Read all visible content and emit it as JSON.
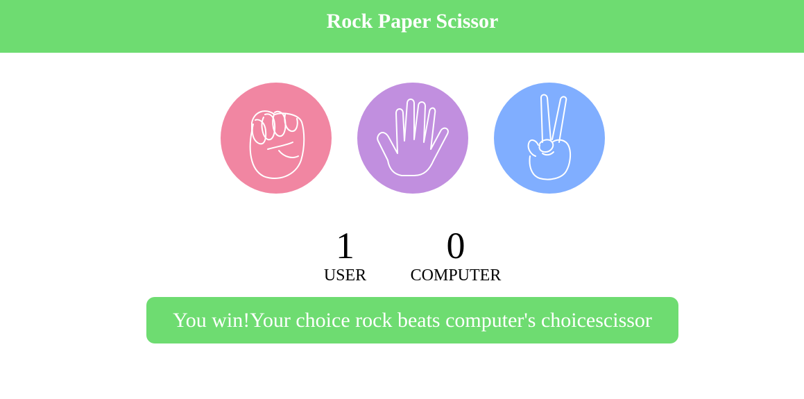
{
  "header": {
    "title": "Rock Paper Scissor"
  },
  "choices": [
    {
      "id": "rock",
      "icon": "fist-icon",
      "color": "#f186a2"
    },
    {
      "id": "paper",
      "icon": "open-hand-icon",
      "color": "#c18fdf"
    },
    {
      "id": "scissor",
      "icon": "victory-hand-icon",
      "color": "#80aeff"
    }
  ],
  "score": {
    "user": {
      "value": "1",
      "label": "USER"
    },
    "computer": {
      "value": "0",
      "label": "COMPUTER"
    }
  },
  "result": {
    "message": "You win!Your choice rock beats computer's choicescissor",
    "color": "#6edc71"
  },
  "colors": {
    "accent": "#6edc71",
    "text_on_accent": "#ffffff"
  }
}
